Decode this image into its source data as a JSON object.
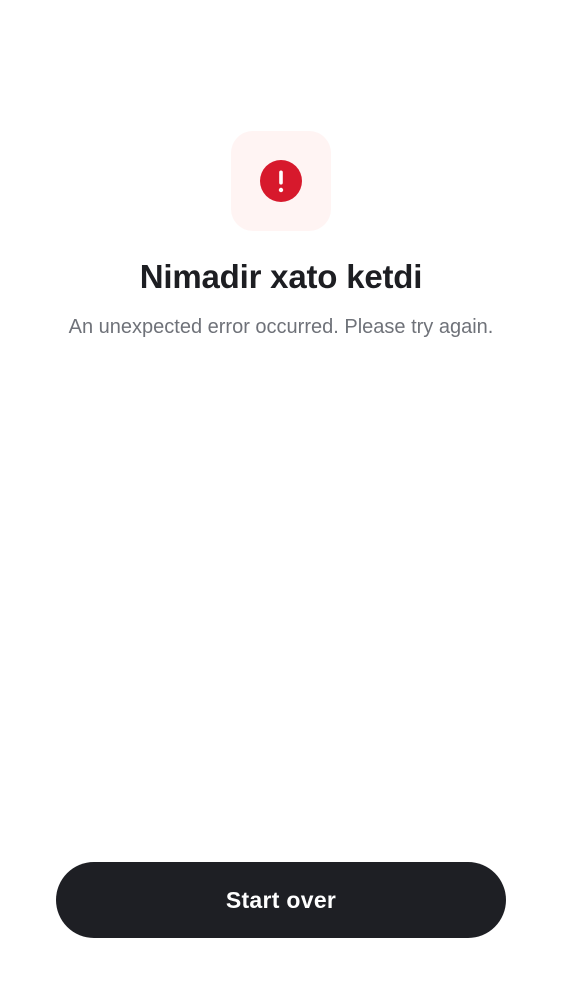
{
  "error_screen": {
    "icon": "exclamation-circle-icon",
    "title": "Nimadir xato ketdi",
    "message": "An unexpected error occurred. Please try again.",
    "colors": {
      "icon_bg": "#fff4f3",
      "icon_fill": "#d7192c",
      "title": "#1d1e22",
      "message": "#6f7279",
      "button_bg": "#1e1f24",
      "button_text": "#ffffff"
    }
  },
  "actions": {
    "start_over_label": "Start over"
  }
}
